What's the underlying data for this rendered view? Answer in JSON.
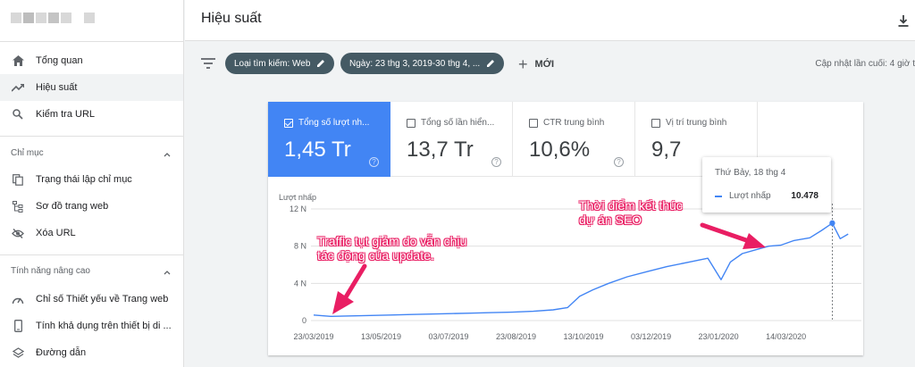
{
  "header": {
    "title": "Hiệu suất"
  },
  "sidebar": {
    "items": [
      {
        "label": "Tổng quan",
        "icon": "home-icon"
      },
      {
        "label": "Hiệu suất",
        "icon": "trending-up-icon",
        "active": true
      },
      {
        "label": "Kiểm tra URL",
        "icon": "search-icon"
      }
    ],
    "section_index": {
      "label": "Chỉ mục",
      "items": [
        {
          "label": "Trạng thái lập chỉ mục",
          "icon": "file-copy-icon"
        },
        {
          "label": "Sơ đồ trang web",
          "icon": "sitemap-icon"
        },
        {
          "label": "Xóa URL",
          "icon": "visibility-off-icon"
        }
      ]
    },
    "section_advanced": {
      "label": "Tính năng nâng cao",
      "items": [
        {
          "label": "Chỉ số Thiết yếu về Trang web",
          "icon": "speed-icon"
        },
        {
          "label": "Tính khả dụng trên thiết bị di ...",
          "icon": "phone-icon"
        },
        {
          "label": "Đường dẫn",
          "icon": "layers-icon"
        }
      ]
    }
  },
  "filters": {
    "search_type": "Loại tìm kiếm: Web",
    "date": "Ngày: 23 thg 3, 2019-30 thg 4, ...",
    "new_label": "MỚI",
    "updated": "Cập nhật lần cuối: 4 giờ t"
  },
  "metrics": [
    {
      "label": "Tổng số lượt nh...",
      "value": "1,45 Tr",
      "checked": true
    },
    {
      "label": "Tổng số lần hiển...",
      "value": "13,7 Tr",
      "checked": false
    },
    {
      "label": "CTR trung bình",
      "value": "10,6%",
      "checked": false
    },
    {
      "label": "Vị trí trung bình",
      "value": "9,7",
      "checked": false
    }
  ],
  "tooltip": {
    "date": "Thứ Bảy, 18 thg 4",
    "series": "Lượt nhấp",
    "value": "10.478"
  },
  "annotations": {
    "left": [
      "Traffic tụt giảm do vẫn chịu",
      "tác động của update."
    ],
    "right": [
      "Thời điểm kết thúc",
      "dự án SEO"
    ]
  },
  "colors": {
    "accent": "#4285f4",
    "chip": "#455a64",
    "annotation": "#e91e63"
  },
  "chart_data": {
    "type": "line",
    "ylabel": "Lượt nhấp",
    "ylim": [
      0,
      12000
    ],
    "yticks": [
      0,
      4000,
      8000,
      12000
    ],
    "ytick_labels": [
      "0",
      "4 N",
      "8 N",
      "12 N"
    ],
    "xtick_labels": [
      "23/03/2019",
      "13/05/2019",
      "03/07/2019",
      "23/08/2019",
      "13/10/2019",
      "03/12/2019",
      "23/01/2020",
      "14/03/2020"
    ],
    "series": [
      {
        "name": "Lượt nhấp",
        "color": "#4285f4",
        "x": [
          "2019-03-23",
          "2019-04-05",
          "2019-04-20",
          "2019-05-05",
          "2019-05-20",
          "2019-06-05",
          "2019-06-20",
          "2019-07-05",
          "2019-07-20",
          "2019-08-05",
          "2019-08-20",
          "2019-09-05",
          "2019-09-20",
          "2019-10-01",
          "2019-10-10",
          "2019-10-20",
          "2019-11-01",
          "2019-11-15",
          "2019-12-01",
          "2019-12-15",
          "2020-01-01",
          "2020-01-15",
          "2020-01-25",
          "2020-02-01",
          "2020-02-10",
          "2020-02-20",
          "2020-03-01",
          "2020-03-10",
          "2020-03-20",
          "2020-04-01",
          "2020-04-10",
          "2020-04-18",
          "2020-04-24",
          "2020-04-30"
        ],
        "values": [
          600,
          450,
          500,
          550,
          600,
          650,
          700,
          750,
          800,
          850,
          900,
          1000,
          1150,
          1400,
          2600,
          3300,
          4000,
          4700,
          5300,
          5800,
          6300,
          6700,
          4400,
          6300,
          7200,
          7600,
          8000,
          8100,
          8600,
          8900,
          9700,
          10478,
          8800,
          9300
        ]
      }
    ],
    "marker": {
      "x": "2020-04-18",
      "value": 10478
    }
  }
}
